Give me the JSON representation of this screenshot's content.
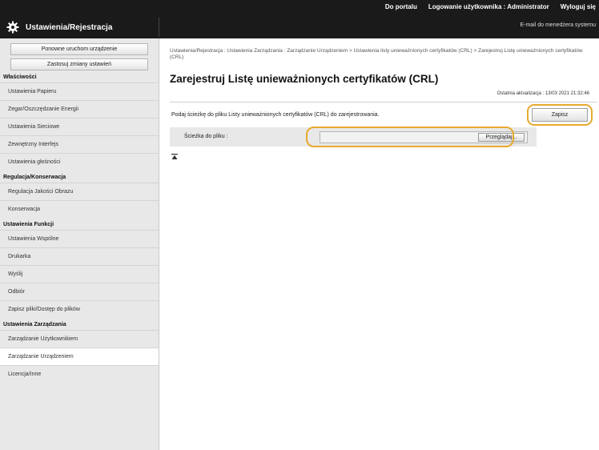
{
  "topbar": {
    "portal_link": "Do portalu",
    "login_user": "Logowanie użytkownika :  Administrator",
    "logout_link": "Wyloguj się",
    "email_link": "E-mail do menedżera systemu",
    "app_title": "Ustawienia/Rejestracja"
  },
  "sidebar": {
    "buttons": [
      "Ponowne uruchom urządzenie",
      "Zastosuj zmiany ustawień"
    ],
    "sections": [
      {
        "header": "Właściwości",
        "items": [
          "Ustawienia Papieru",
          "Zegar/Oszczędzanie Energii",
          "Ustawienia Sieciowe",
          "Zewnętrzny Interfejs",
          "Ustawienia głośności"
        ]
      },
      {
        "header": "Regulacja/Konserwacja",
        "items": [
          "Regulacja Jakości Obrazu",
          "Konserwacja"
        ]
      },
      {
        "header": "Ustawienia Funkcji",
        "items": [
          "Ustawienia Wspólne",
          "Drukarka",
          "Wyślij",
          "Odbiór",
          "Zapisz pliki/Dostęp do plików"
        ]
      },
      {
        "header": "Ustawienia Zarządzania",
        "items": [
          "Zarządzanie Użytkownikiem",
          "Zarządzanie Urządzeniem",
          "Licencja/Inne"
        ]
      }
    ],
    "active_item": "Zarządzanie Urządzeniem"
  },
  "main": {
    "breadcrumb": "Ustawienia/Rejestracja : Ustawienia Zarządzania : Zarządzanie Urządzeniem > Ustawienia listy unieważnionych certyfikatów (CRL) > Zarejestruj Listę unieważnionych certyfikatów (CRL)",
    "title": "Zarejestruj Listę unieważnionych certyfikatów (CRL)",
    "last_update": "Ostatnia aktualizacja : 13/03 2021 21:32:46",
    "instruction": "Podaj ścieżkę do pliku Listy unieważnionych certyfikatów (CRL) do zarejestrowania.",
    "save_label": "Zapisz",
    "path_label": "Ścieżka do pliku :",
    "path_value": "",
    "browse_label": "Przeglądaj..."
  },
  "colors": {
    "highlight": "#e8a92e",
    "topbar": "#1a1a1a",
    "sidebar": "#e8e8e8"
  }
}
